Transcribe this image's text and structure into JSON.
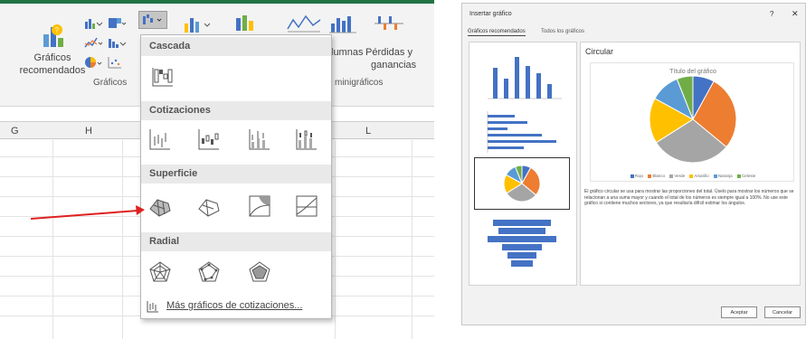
{
  "excel": {
    "ribbon": {
      "recommended_label_1": "Gráficos",
      "recommended_label_2": "recomendados",
      "group_label": "Gráficos",
      "minigraph_label": "minigráficos",
      "columns_label": "lumnas",
      "winloss_label_1": "Pérdidas y",
      "winloss_label_2": "ganancias"
    },
    "columns": [
      "G",
      "H",
      "L"
    ],
    "dropdown": {
      "sections": [
        "Cascada",
        "Cotizaciones",
        "Superficie",
        "Radial"
      ],
      "footer_link": "Más gráficos de cotizaciones..."
    }
  },
  "dialog": {
    "title": "Insertar gráfico",
    "help": "?",
    "close": "✕",
    "tabs": [
      "Gráficos recomendados",
      "Todos los gráficos"
    ],
    "preview_title": "Circular",
    "chart_title": "Título del gráfico",
    "legend": [
      "Rojo",
      "Blanco",
      "Verde",
      "Amarillo",
      "Naranja",
      "Celeste"
    ],
    "description": "El gráfico circular se usa para mostrar las proporciones del total. Úselo para mostrar los números que se relacionan a una suma mayor y cuando el total de los números es siempre igual a 100%. No use este gráfico si contiene muchos sectores, ya que resultaría difícil estimar los ángulos.",
    "ok_button": "Aceptar",
    "cancel_button": "Cancelar",
    "colors": {
      "blue": "#4472c4",
      "orange": "#ed7d31",
      "gray": "#a5a5a5",
      "yellow": "#ffc000",
      "lightblue": "#5b9bd5",
      "green": "#70ad47"
    }
  },
  "chart_data": {
    "type": "pie",
    "title": "Título del gráfico",
    "categories": [
      "Rojo",
      "Blanco",
      "Verde",
      "Amarillo",
      "Naranja",
      "Celeste"
    ],
    "values": [
      8,
      28,
      30,
      17,
      11,
      6
    ]
  }
}
